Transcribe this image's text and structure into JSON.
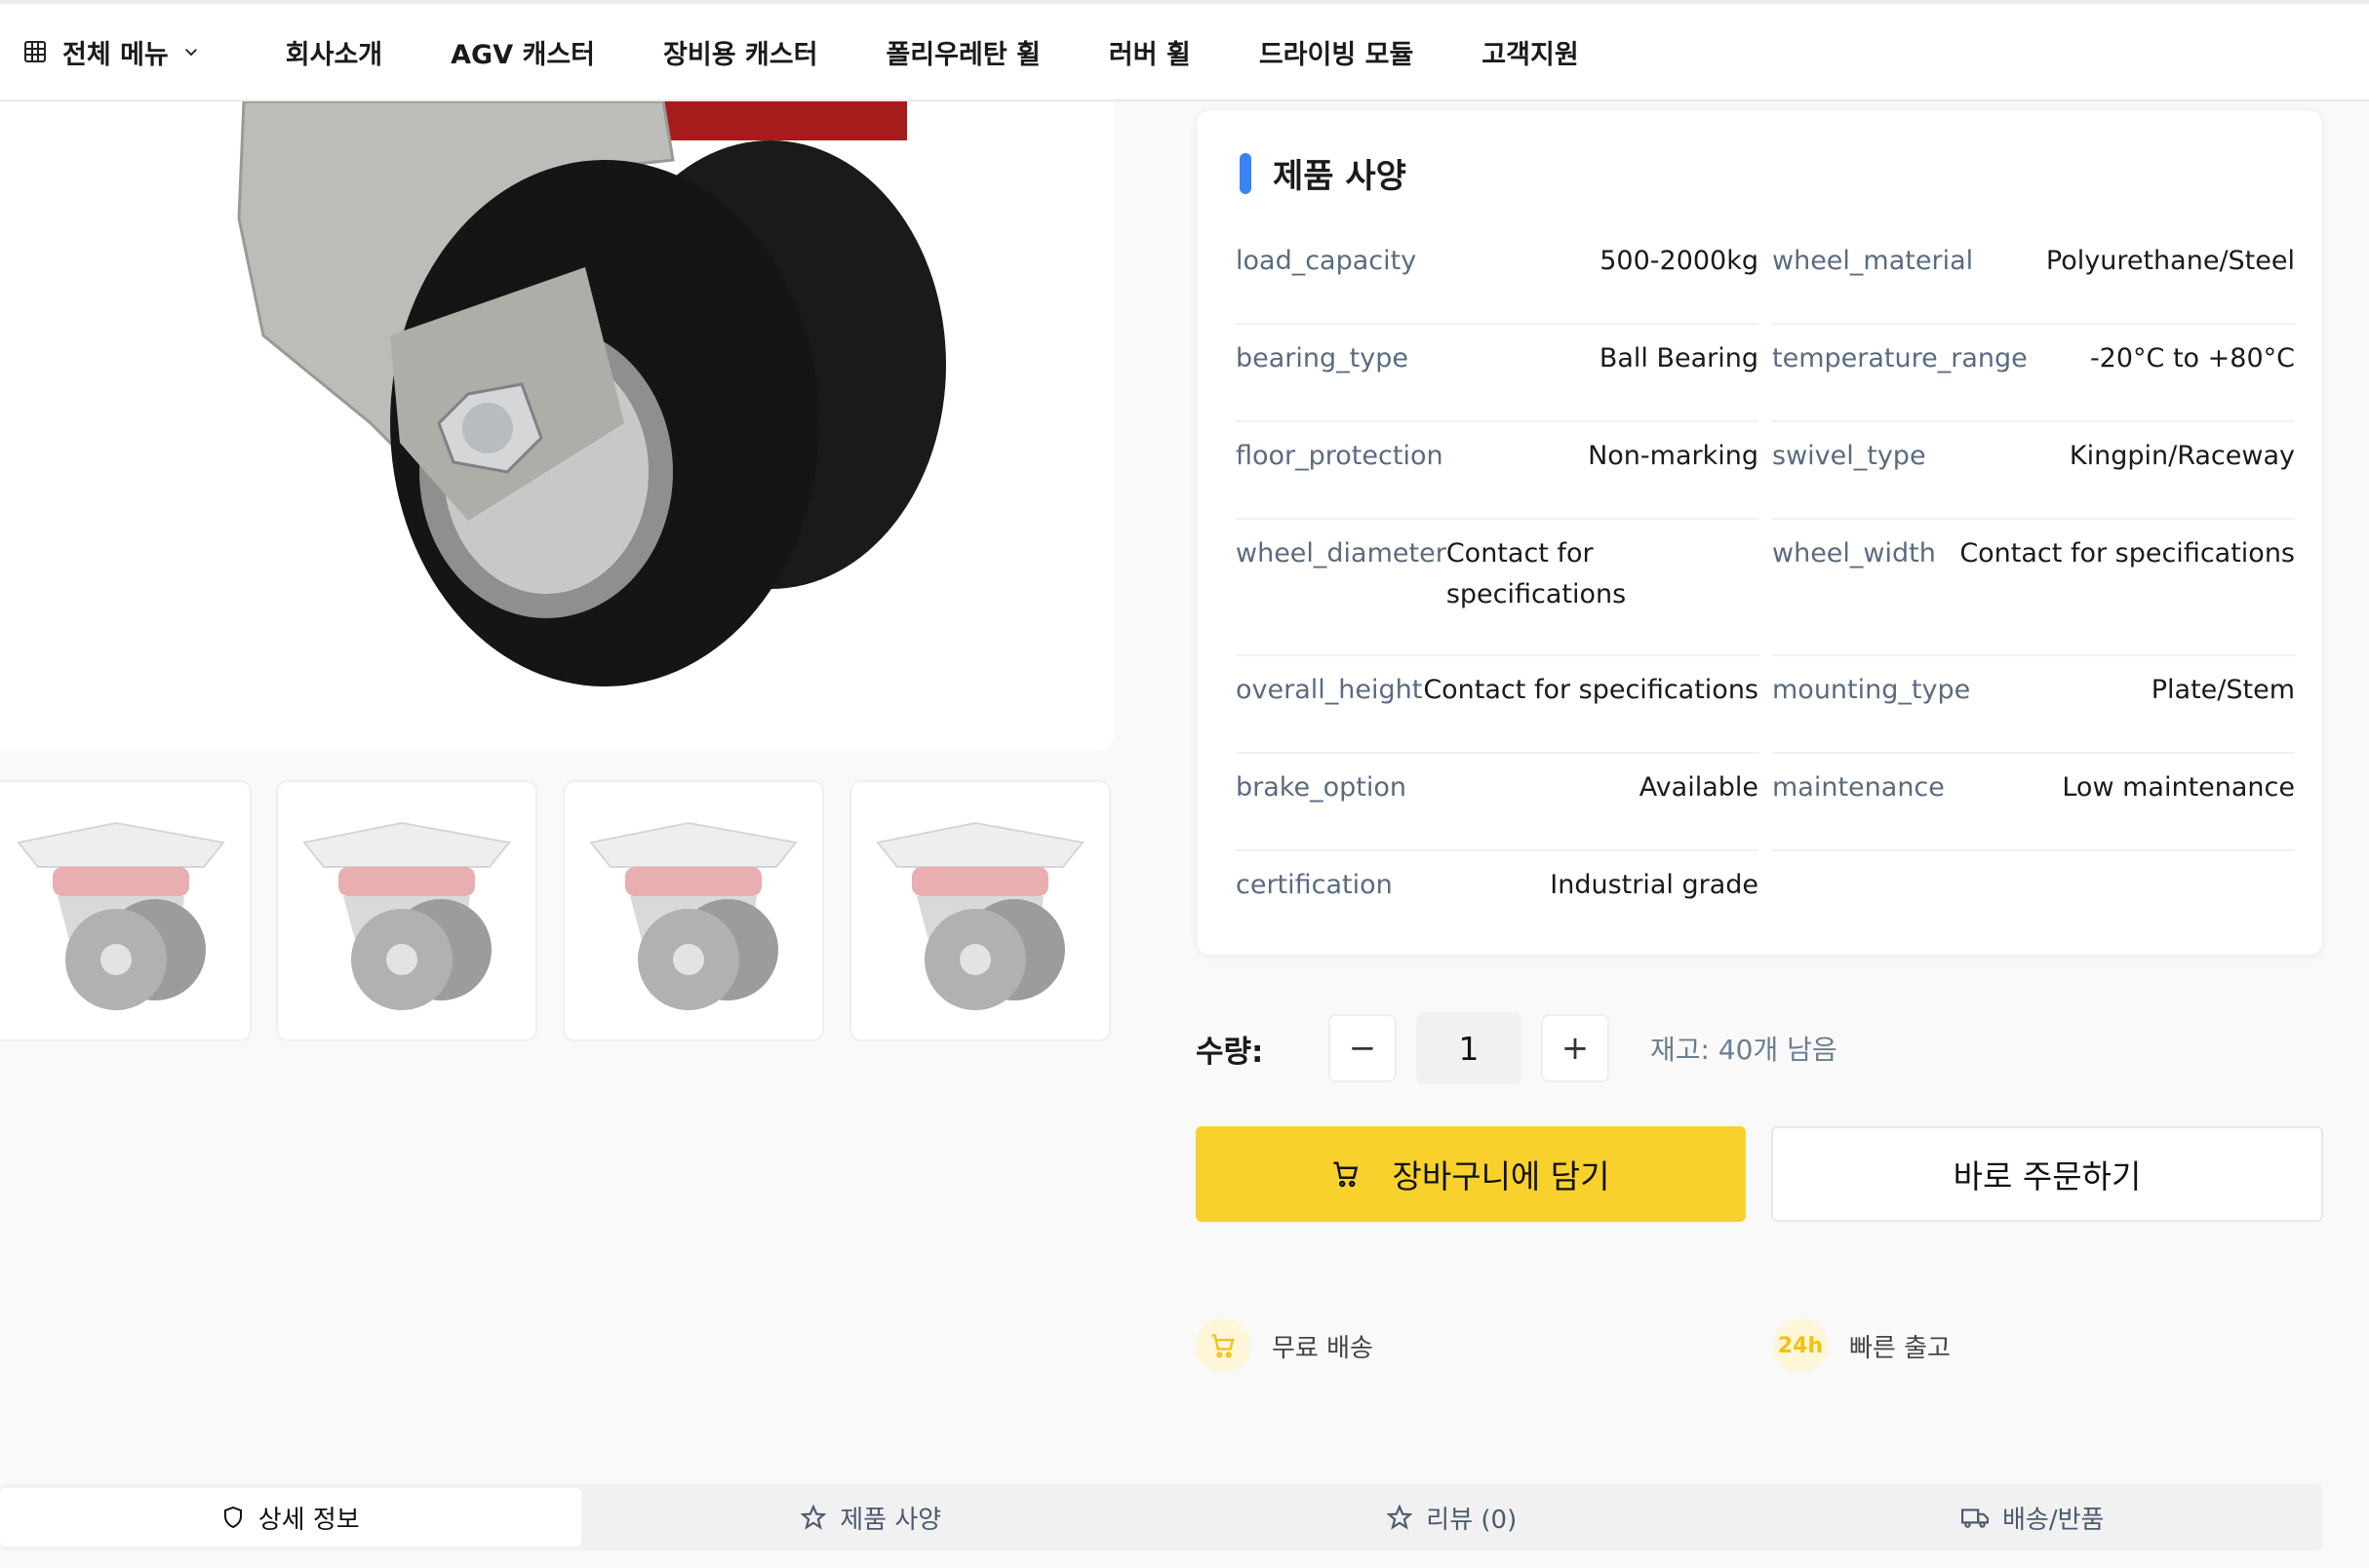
{
  "nav": {
    "all_menu": "전체 메뉴",
    "items": [
      "회사소개",
      "AGV 캐스터",
      "장비용 캐스터",
      "폴리우레탄 휠",
      "러버 휠",
      "드라이빙 모듈",
      "고객지원"
    ]
  },
  "spec": {
    "title": "제품 사양",
    "rows": [
      {
        "k1": "load_capacity",
        "v1": "500-2000kg",
        "k2": "wheel_material",
        "v2": "Polyurethane/Steel"
      },
      {
        "k1": "bearing_type",
        "v1": "Ball Bearing",
        "k2": "temperature_range",
        "v2": "-20°C to +80°C"
      },
      {
        "k1": "floor_protection",
        "v1": "Non-marking",
        "k2": "swivel_type",
        "v2": "Kingpin/Raceway"
      },
      {
        "k1": "wheel_diameter",
        "v1": "Contact for specifications",
        "k2": "wheel_width",
        "v2": "Contact for specifications"
      },
      {
        "k1": "overall_height",
        "v1": "Contact for specifications",
        "k2": "mounting_type",
        "v2": "Plate/Stem"
      },
      {
        "k1": "brake_option",
        "v1": "Available",
        "k2": "maintenance",
        "v2": "Low maintenance"
      },
      {
        "k1": "certification",
        "v1": "Industrial grade"
      }
    ]
  },
  "quantity": {
    "label": "수량:",
    "minus": "−",
    "value": "1",
    "plus": "+",
    "stock": "재고: 40개 남음"
  },
  "actions": {
    "cart": "장바구니에 담기",
    "buy": "바로 주문하기"
  },
  "features": [
    {
      "text": "무료 배송",
      "icon": "cart-icon"
    },
    {
      "text": "빠른 출고",
      "icon": "24h-icon",
      "badge": "24h"
    }
  ],
  "tabs": [
    {
      "label": "상세 정보",
      "icon": "shield-icon"
    },
    {
      "label": "제품 사양",
      "icon": "star-icon"
    },
    {
      "label": "리뷰 (0)",
      "icon": "star-icon"
    },
    {
      "label": "배송/반품",
      "icon": "truck-icon"
    }
  ],
  "colors": {
    "accent": "#3b82f6",
    "cart_button": "#f9d12c"
  }
}
